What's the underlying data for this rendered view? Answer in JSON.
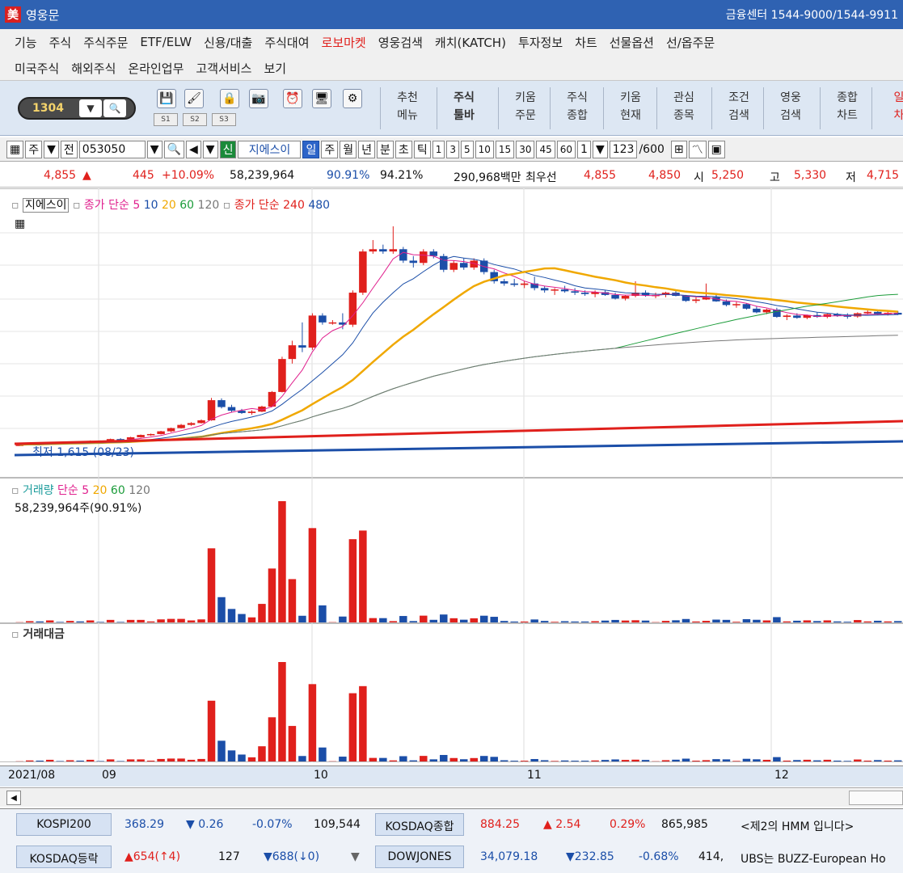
{
  "window": {
    "title": "영웅문",
    "center": "금융센터 1544-9000/1544-9911"
  },
  "menu": {
    "row1": [
      "기능",
      "주식",
      "주식주문",
      "ETF/ELW",
      "신용/대출",
      "주식대여",
      "로보마켓",
      "영웅검색",
      "캐치(KATCH)",
      "투자정보",
      "차트",
      "선물옵션",
      "선/옵주문"
    ],
    "row2": [
      "미국주식",
      "해외주식",
      "온라인업무",
      "고객서비스",
      "보기"
    ],
    "red_item": "로보마켓"
  },
  "toolbar": {
    "screen_no": "1304",
    "slots": [
      "S1",
      "S2",
      "S3"
    ],
    "buttons": [
      [
        "추천",
        "메뉴"
      ],
      [
        "주식",
        "툴바"
      ],
      [
        "키움",
        "주문"
      ],
      [
        "주식",
        "종합"
      ],
      [
        "키움",
        "현재"
      ],
      [
        "관심",
        "종목"
      ],
      [
        "조건",
        "검색"
      ],
      [
        "영웅",
        "검색"
      ],
      [
        "종합",
        "차트"
      ],
      [
        "일",
        "차"
      ]
    ]
  },
  "control": {
    "market": "주",
    "prev": "전",
    "code": "053050",
    "badge": "신",
    "name": "지에스이",
    "periods": [
      "일",
      "주",
      "월",
      "년",
      "분",
      "초",
      "틱"
    ],
    "nums": [
      "1",
      "3",
      "5",
      "10",
      "15",
      "30",
      "45",
      "60"
    ],
    "count": "1",
    "view": "123",
    "total": "/600"
  },
  "quote": {
    "price": "4,855",
    "price_arrow": "▲",
    "change": "445",
    "rate": "+10.09%",
    "volume": "58,239,964",
    "vol_rate": "90.91%",
    "turnover_rate": "94.21%",
    "amount": "290,968백만",
    "best_label": "최우선",
    "ask": "4,855",
    "bid": "4,850",
    "open_label": "시",
    "open": "5,250",
    "high_label": "고",
    "high": "5,330",
    "low_label": "저",
    "low": "4,715"
  },
  "price_legend": {
    "name": "지에스이",
    "ma_label": "종가 단순",
    "ma": [
      "5",
      "10",
      "20",
      "60",
      "120"
    ],
    "ma2_label": "종가 단순",
    "ma2": [
      "240",
      "480"
    ],
    "low_note": "최저 1,615 (08/23)"
  },
  "volume_legend": {
    "title": "거래량",
    "ma_label": "단순",
    "ma": [
      "5",
      "20",
      "60",
      "120"
    ],
    "value": "58,239,964주(90.91%)"
  },
  "amount_legend": {
    "title": "거래대금"
  },
  "xaxis": {
    "labels": [
      "2021/08",
      "09",
      "10",
      "11",
      "12"
    ]
  },
  "ticker": {
    "kospi200_label": "KOSPI200",
    "kospi200": "368.29",
    "kospi200_chg": "▼ 0.26",
    "kospi200_rate": "-0.07%",
    "kospi200_vol": "109,544",
    "kosdaq_label": "KOSDAQ종합",
    "kosdaq": "884.25",
    "kosdaq_chg": "▲ 2.54",
    "kosdaq_rate": "0.29%",
    "kosdaq_vol": "865,985",
    "news1": "<제2의 HMM 입니다>",
    "breadth_label": "KOSDAQ등락",
    "up": "▲654(↑4)",
    "flat": "127",
    "down": "▼688(↓0)",
    "dow_label": "DOWJONES",
    "dow": "34,079.18",
    "dow_chg": "▼232.85",
    "dow_rate": "-0.68%",
    "dow_vol": "414,",
    "news2": "UBS는 BUZZ-European Ho"
  },
  "chart_data": {
    "type": "candlestick",
    "candles": [
      [
        1620,
        1640,
        1600,
        1625
      ],
      [
        1625,
        1660,
        1615,
        1650
      ],
      [
        1650,
        1660,
        1620,
        1630
      ],
      [
        1630,
        1680,
        1625,
        1670
      ],
      [
        1670,
        1690,
        1650,
        1660
      ],
      [
        1660,
        1700,
        1640,
        1690
      ],
      [
        1690,
        1700,
        1660,
        1670
      ],
      [
        1670,
        1720,
        1660,
        1710
      ],
      [
        1710,
        1720,
        1690,
        1700
      ],
      [
        1700,
        1760,
        1700,
        1750
      ],
      [
        1750,
        1770,
        1720,
        1740
      ],
      [
        1740,
        1800,
        1730,
        1790
      ],
      [
        1790,
        1850,
        1780,
        1840
      ],
      [
        1840,
        1870,
        1820,
        1860
      ],
      [
        1860,
        1930,
        1850,
        1920
      ],
      [
        1920,
        2000,
        1900,
        1990
      ],
      [
        1990,
        2080,
        1980,
        2060
      ],
      [
        2060,
        2120,
        2040,
        2100
      ],
      [
        2100,
        2180,
        2090,
        2160
      ],
      [
        2160,
        2650,
        2150,
        2600
      ],
      [
        2600,
        2640,
        2420,
        2450
      ],
      [
        2450,
        2500,
        2340,
        2370
      ],
      [
        2370,
        2410,
        2300,
        2320
      ],
      [
        2320,
        2380,
        2280,
        2350
      ],
      [
        2350,
        2480,
        2340,
        2460
      ],
      [
        2460,
        2800,
        2450,
        2780
      ],
      [
        2780,
        3550,
        2770,
        3500
      ],
      [
        3500,
        3900,
        3400,
        3800
      ],
      [
        3800,
        4300,
        3650,
        3750
      ],
      [
        3750,
        4500,
        3700,
        4450
      ],
      [
        4450,
        4500,
        4250,
        4300
      ],
      [
        4300,
        4350,
        4250,
        4300
      ],
      [
        4300,
        4500,
        4150,
        4250
      ],
      [
        4250,
        5000,
        4200,
        4950
      ],
      [
        4950,
        5900,
        4900,
        5850
      ],
      [
        5850,
        6100,
        5800,
        5900
      ],
      [
        5900,
        6000,
        5800,
        5850
      ],
      [
        5850,
        6400,
        5800,
        5900
      ],
      [
        5900,
        5950,
        5600,
        5650
      ],
      [
        5650,
        5750,
        5500,
        5600
      ],
      [
        5600,
        5900,
        5550,
        5850
      ],
      [
        5850,
        5900,
        5700,
        5750
      ],
      [
        5750,
        5800,
        5400,
        5450
      ],
      [
        5450,
        5650,
        5400,
        5600
      ],
      [
        5600,
        5700,
        5450,
        5500
      ],
      [
        5500,
        5700,
        5450,
        5650
      ],
      [
        5650,
        5700,
        5350,
        5400
      ],
      [
        5400,
        5450,
        5150,
        5200
      ],
      [
        5200,
        5250,
        5100,
        5150
      ],
      [
        5150,
        5250,
        5080,
        5120
      ],
      [
        5120,
        5200,
        5050,
        5150
      ],
      [
        5150,
        5300,
        5000,
        5050
      ],
      [
        5050,
        5100,
        4950,
        5000
      ],
      [
        5000,
        5050,
        4900,
        5020
      ],
      [
        5020,
        5100,
        4950,
        4980
      ],
      [
        4980,
        5050,
        4900,
        4950
      ],
      [
        4950,
        5000,
        4880,
        4920
      ],
      [
        4920,
        5000,
        4850,
        4960
      ],
      [
        4960,
        5000,
        4880,
        4900
      ],
      [
        4900,
        4950,
        4800,
        4820
      ],
      [
        4820,
        4900,
        4780,
        4880
      ],
      [
        4880,
        5200,
        4850,
        4950
      ],
      [
        4950,
        5000,
        4860,
        4890
      ],
      [
        4890,
        4950,
        4830,
        4900
      ],
      [
        4900,
        4970,
        4850,
        4950
      ],
      [
        4950,
        5000,
        4870,
        4880
      ],
      [
        4880,
        4900,
        4750,
        4770
      ],
      [
        4770,
        4850,
        4720,
        4800
      ],
      [
        4800,
        5150,
        4790,
        4850
      ],
      [
        4850,
        4900,
        4750,
        4760
      ],
      [
        4760,
        4800,
        4650,
        4680
      ],
      [
        4680,
        4750,
        4620,
        4700
      ],
      [
        4700,
        4720,
        4580,
        4600
      ],
      [
        4600,
        4650,
        4500,
        4520
      ],
      [
        4520,
        4600,
        4480,
        4580
      ],
      [
        4580,
        4620,
        4400,
        4420
      ],
      [
        4420,
        4480,
        4350,
        4450
      ],
      [
        4450,
        4500,
        4380,
        4400
      ],
      [
        4400,
        4470,
        4370,
        4460
      ],
      [
        4460,
        4520,
        4400,
        4420
      ],
      [
        4420,
        4490,
        4390,
        4480
      ],
      [
        4480,
        4510,
        4420,
        4450
      ],
      [
        4450,
        4500,
        4380,
        4430
      ],
      [
        4430,
        4520,
        4400,
        4500
      ],
      [
        4500,
        4560,
        4470,
        4530
      ],
      [
        4530,
        4560,
        4460,
        4480
      ],
      [
        4480,
        4540,
        4450,
        4510
      ],
      [
        4510,
        4550,
        4460,
        4470
      ]
    ]
  }
}
